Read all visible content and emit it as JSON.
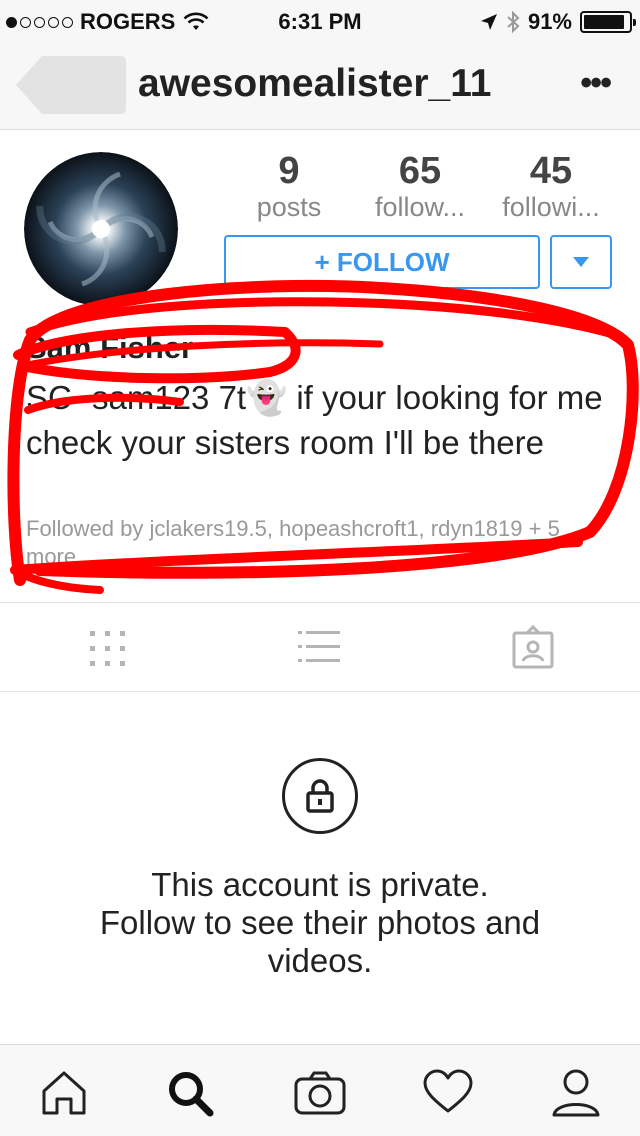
{
  "status_bar": {
    "carrier": "ROGERS",
    "time": "6:31 PM",
    "battery_percent": "91%",
    "battery_level": 0.91,
    "signal_bars": 1,
    "icons": [
      "wifi-icon",
      "location-arrow-icon",
      "bluetooth-icon",
      "battery-icon"
    ]
  },
  "nav": {
    "username": "awesomealister_11",
    "more_label": "•••"
  },
  "profile": {
    "stats": [
      {
        "value": "9",
        "label": "posts"
      },
      {
        "value": "65",
        "label": "follow..."
      },
      {
        "value": "45",
        "label": "followi..."
      }
    ],
    "follow_label": "+ FOLLOW",
    "accent": "#3897f0"
  },
  "bio": {
    "name": "Sam Fisher",
    "text": "SC- sam123 7t👻 if your looking for me check your sisters room I'll be there",
    "followed_by": "Followed by jclakers19.5, hopeashcroft1, rdyn1819 + 5 more"
  },
  "annotation_color": "#ff0000",
  "tabs": [
    "grid-view-icon",
    "list-view-icon",
    "tagged-photos-icon"
  ],
  "private": {
    "line1": "This account is private.",
    "line2": "Follow to see their photos and videos."
  },
  "bottom_bar": [
    "home-icon",
    "search-icon",
    "camera-icon",
    "heart-icon",
    "profile-icon"
  ]
}
